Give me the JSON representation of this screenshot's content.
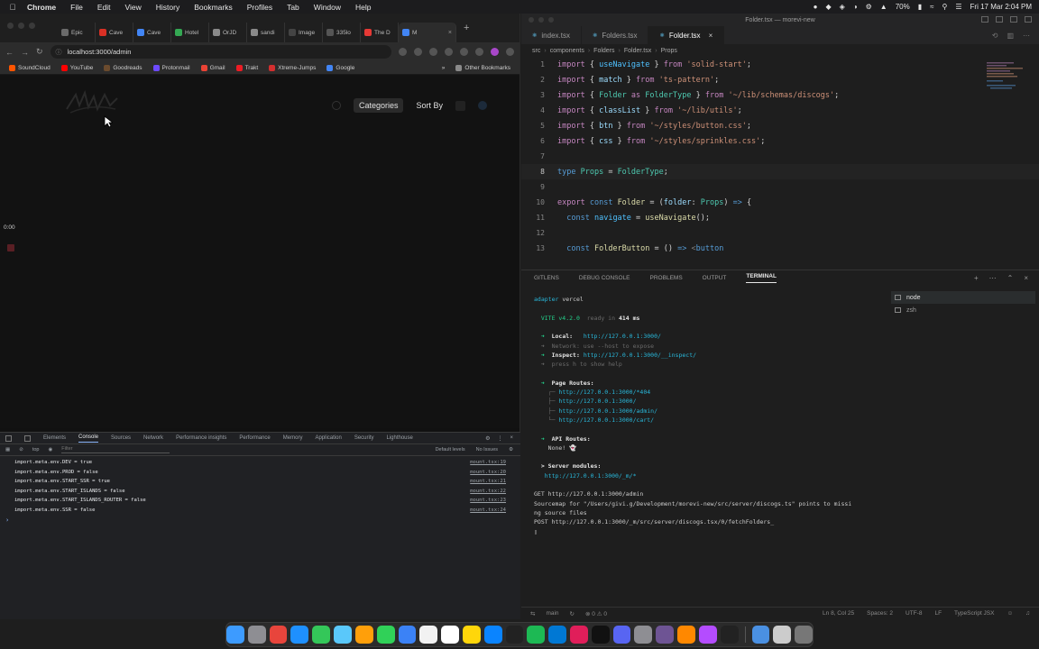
{
  "menubar": {
    "app": "Chrome",
    "items": [
      "File",
      "Edit",
      "View",
      "History",
      "Bookmarks",
      "Profiles",
      "Tab",
      "Window",
      "Help"
    ],
    "battery": "70%",
    "datetime": "Fri 17 Mar 2:04 PM"
  },
  "chrome": {
    "tabs": [
      {
        "label": "Epic",
        "color": "#6b6b6b"
      },
      {
        "label": "Cave",
        "color": "#d93025"
      },
      {
        "label": "Cave",
        "color": "#4285f4"
      },
      {
        "label": "Hotel",
        "color": "#34a853"
      },
      {
        "label": "OrJD",
        "color": "#8a8a8a"
      },
      {
        "label": "sandi",
        "color": "#8a8a8a"
      },
      {
        "label": "Image",
        "color": "#444444"
      },
      {
        "label": "335lo",
        "color": "#555555"
      },
      {
        "label": "The D",
        "color": "#e53935"
      },
      {
        "label": "M",
        "color": "#4285f4",
        "active": true
      }
    ],
    "url": "localhost:3000/admin",
    "bookmarks": [
      {
        "label": "SoundCloud",
        "color": "#ff5500"
      },
      {
        "label": "YouTube",
        "color": "#ff0000"
      },
      {
        "label": "Goodreads",
        "color": "#6b4b2e"
      },
      {
        "label": "Protonmail",
        "color": "#6d4aff"
      },
      {
        "label": "Gmail",
        "color": "#ea4335"
      },
      {
        "label": "Trakt",
        "color": "#ed1c24"
      },
      {
        "label": "Xtreme-Jumps",
        "color": "#d32f2f"
      },
      {
        "label": "Google",
        "color": "#4285f4"
      }
    ],
    "other_bookmarks": "Other Bookmarks"
  },
  "app": {
    "categories": "Categories",
    "sort_by": "Sort By"
  },
  "recording": {
    "timer": "0:00"
  },
  "devtools": {
    "tabs": [
      "Elements",
      "Console",
      "Sources",
      "Network",
      "Performance insights",
      "Performance",
      "Memory",
      "Application",
      "Security",
      "Lighthouse"
    ],
    "active_tab": "Console",
    "context": "top",
    "filter_placeholder": "Filter",
    "levels": "Default levels",
    "issues": "No Issues",
    "logs": [
      {
        "text": "import.meta.env.DEV = true",
        "src": "mount.tsx:19"
      },
      {
        "text": "import.meta.env.PROD = false",
        "src": "mount.tsx:20"
      },
      {
        "text": "import.meta.env.START_SSR = true",
        "src": "mount.tsx:21"
      },
      {
        "text": "import.meta.env.START_ISLANDS = false",
        "src": "mount.tsx:22"
      },
      {
        "text": "import.meta.env.START_ISLANDS_ROUTER = false",
        "src": "mount.tsx:23"
      },
      {
        "text": "import.meta.env.SSR = false",
        "src": "mount.tsx:24"
      }
    ]
  },
  "vscode": {
    "title": "Folder.tsx — morevi-new",
    "tabs": [
      {
        "label": "index.tsx"
      },
      {
        "label": "Folders.tsx"
      },
      {
        "label": "Folder.tsx",
        "active": true
      }
    ],
    "breadcrumb": [
      "src",
      "components",
      "Folders",
      "Folder.tsx",
      "Props"
    ],
    "line_numbers": [
      "1",
      "2",
      "3",
      "4",
      "5",
      "6",
      "7",
      "8",
      "9",
      "10",
      "11",
      "12",
      "13"
    ],
    "panel_tabs": [
      "GITLENS",
      "DEBUG CONSOLE",
      "PROBLEMS",
      "OUTPUT",
      "TERMINAL"
    ],
    "active_panel": "TERMINAL",
    "terminals": [
      "node",
      "zsh"
    ],
    "terminal": {
      "adapter_label": "adapter",
      "adapter_value": "vercel",
      "vite": "VITE v4.2.0",
      "ready": "ready in",
      "ready_ms": "414 ms",
      "local_label": "Local:",
      "local_url": "http://127.0.0.1:3000/",
      "network": "Network: use --host to expose",
      "inspect_label": "Inspect:",
      "inspect_url": "http://127.0.0.1:3000/__inspect/",
      "help": "press h to show help",
      "page_routes": "Page Routes:",
      "routes": [
        "http://127.0.0.1:3000/*404",
        "http://127.0.0.1:3000/",
        "http://127.0.0.1:3000/admin/",
        "http://127.0.0.1:3000/cart/"
      ],
      "api_routes": "API Routes:",
      "api_none": "None! 👻",
      "server_modules": "Server modules:",
      "server_url": "http://127.0.0.1:3000/_m/*",
      "get_line": "GET http://127.0.0.1:3000/admin",
      "sourcemap_1": "Sourcemap for \"/Users/givi.g/Development/morevi-new/src/server/discogs.ts\" points to missi",
      "sourcemap_2": "ng source files",
      "post_line": "POST http://127.0.0.1:3000/_m/src/server/discogs.tsx/0/fetchFolders_"
    },
    "status": {
      "branch": "main",
      "errors": "0",
      "warnings": "0",
      "cursor": "Ln 8, Col 25",
      "spaces": "Spaces: 2",
      "encoding": "UTF-8",
      "eol": "LF",
      "language": "TypeScript JSX"
    }
  },
  "dock": {
    "apps": [
      {
        "name": "finder",
        "color": "#3d9bff"
      },
      {
        "name": "launchpad",
        "color": "#8e8e93"
      },
      {
        "name": "chrome",
        "color": "#e8453c"
      },
      {
        "name": "safari",
        "color": "#1e90ff"
      },
      {
        "name": "messages",
        "color": "#34c759"
      },
      {
        "name": "maps",
        "color": "#5ac8fa"
      },
      {
        "name": "photos",
        "color": "#ff9f0a"
      },
      {
        "name": "facetime",
        "color": "#30d158"
      },
      {
        "name": "mail",
        "color": "#3b82f6"
      },
      {
        "name": "calendar",
        "color": "#f2f2f2"
      },
      {
        "name": "reminders",
        "color": "#ffffff"
      },
      {
        "name": "notes",
        "color": "#ffd60a"
      },
      {
        "name": "appstore",
        "color": "#0a84ff"
      },
      {
        "name": "live",
        "color": "#222222"
      },
      {
        "name": "spotify",
        "color": "#1db954"
      },
      {
        "name": "vscode",
        "color": "#0078d4"
      },
      {
        "name": "slack",
        "color": "#e01e5a"
      },
      {
        "name": "terminal",
        "color": "#111111"
      },
      {
        "name": "discord",
        "color": "#5865f2"
      },
      {
        "name": "settings",
        "color": "#8e8e93"
      },
      {
        "name": "github",
        "color": "#6e5494"
      },
      {
        "name": "vlc",
        "color": "#ff8800"
      },
      {
        "name": "misc",
        "color": "#b44cff"
      },
      {
        "name": "live2",
        "color": "#222222"
      },
      {
        "name": "preview",
        "color": "#4a90e2"
      },
      {
        "name": "notes2",
        "color": "#cccccc"
      },
      {
        "name": "trash",
        "color": "#777777"
      }
    ]
  }
}
